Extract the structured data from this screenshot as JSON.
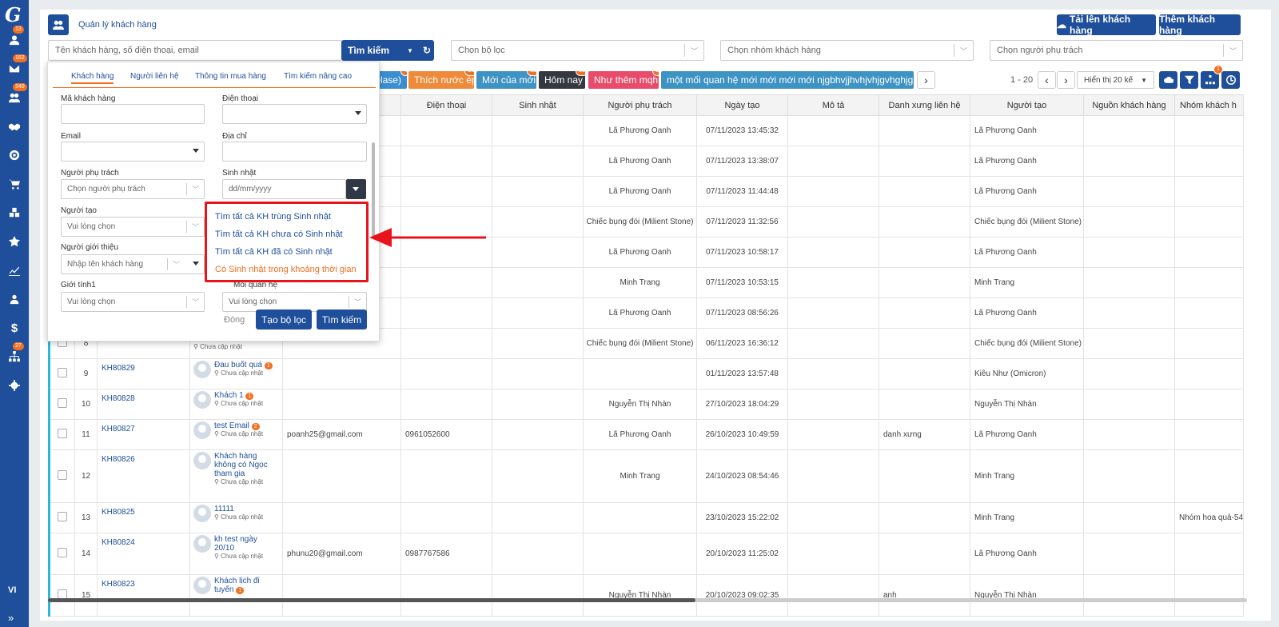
{
  "sidebar": {
    "logo": "G",
    "badges": {
      "b1": "13",
      "b2": "162",
      "b3": "340",
      "b4": "27"
    },
    "lang": "VI",
    "expand": "»"
  },
  "header": {
    "title": "Quản lý khách hàng",
    "upload_label": "Tải lên khách hàng",
    "add_label": "Thêm khách hàng"
  },
  "search": {
    "placeholder": "Tên khách hàng, số điện thoại, email",
    "button": "Tìm kiếm",
    "filter_placeholder": "Chọn bộ lọc",
    "group_placeholder": "Chọn nhóm khách hàng",
    "owner_placeholder": "Chọn người phụ trách"
  },
  "tags": [
    {
      "label": "elase)",
      "color": "#3b8fd1"
    },
    {
      "label": "Thích nước ép",
      "color": "#ee8a3a",
      "badge": "38"
    },
    {
      "label": "Mới của mới",
      "color": "#3d93c3",
      "badge": "13"
    },
    {
      "label": "Hôm nay",
      "color": "#35393f",
      "badge": "15"
    },
    {
      "label": "Như thêm mqh",
      "color": "#e94b6b",
      "badge": "0"
    },
    {
      "label": "một mối quan hệ mới mới mới mới njgbhvjjhvhjvhjgvhghjg",
      "color": "#3d93c3"
    }
  ],
  "tag0_badge": "4",
  "pagination": {
    "range": "1 - 20",
    "per_page": "Hiển thị 20 kế",
    "filter_badge": "1"
  },
  "columns": [
    "Điện thoại",
    "Sinh nhật",
    "Người phụ trách",
    "Ngày tạo",
    "Mô tả",
    "Danh xưng liên hệ",
    "Người tạo",
    "Nguồn khách hàng",
    "Nhóm khách h"
  ],
  "rows": [
    {
      "phone": "",
      "owner": "Lã Phương Oanh",
      "created": "07/11/2023 13:45:32",
      "title": "",
      "creator": "Lã Phương Oanh",
      "group": ""
    },
    {
      "phone": "",
      "owner": "Lã Phương Oanh",
      "created": "07/11/2023 13:38:07",
      "title": "",
      "creator": "Lã Phương Oanh",
      "group": ""
    },
    {
      "phone": "",
      "owner": "Lã Phương Oanh",
      "created": "07/11/2023 11:44:48",
      "title": "",
      "creator": "Lã Phương Oanh",
      "group": ""
    },
    {
      "phone": "",
      "owner": "Chiếc bụng đói (Milient Stone)",
      "created": "07/11/2023 11:32:56",
      "title": "",
      "creator": "Chiếc bụng đói (Milient Stone)",
      "group": ""
    },
    {
      "phone": "",
      "owner": "Lã Phương Oanh",
      "created": "07/11/2023 10:58:17",
      "title": "",
      "creator": "Lã Phương Oanh",
      "group": ""
    },
    {
      "phone": "",
      "owner": "Minh Trang",
      "created": "07/11/2023 10:53:15",
      "title": "",
      "creator": "Minh Trang",
      "group": ""
    },
    {
      "phone": "",
      "owner": "Lã Phương Oanh",
      "created": "07/11/2023 08:56:26",
      "title": "",
      "creator": "Lã Phương Oanh",
      "group": ""
    },
    {
      "idx": "8",
      "name_tail": "Chưa cập nhật",
      "email": "",
      "phone": "",
      "owner": "Chiếc bụng đói (Milient Stone)",
      "created": "06/11/2023 16:36:12",
      "title": "",
      "creator": "Chiếc bụng đói (Milient Stone)",
      "group": ""
    },
    {
      "idx": "9",
      "code": "KH80829",
      "name": "Đau buốt quá",
      "badge": "1",
      "updated": "Chưa cập nhật",
      "email": "",
      "phone": "",
      "owner": "",
      "created": "01/11/2023 13:57:48",
      "title": "",
      "creator": "Kiều Như (Omicron)",
      "group": ""
    },
    {
      "idx": "10",
      "code": "KH80828",
      "name": "Khách 1",
      "badge": "1",
      "updated": "Chưa cập nhật",
      "email": "",
      "phone": "",
      "owner": "Nguyễn Thị Nhàn",
      "created": "27/10/2023 18:04:29",
      "title": "",
      "creator": "Nguyễn Thị Nhàn",
      "group": ""
    },
    {
      "idx": "11",
      "code": "KH80827",
      "name": "test Email",
      "badge": "2",
      "updated": "Chưa cập nhật",
      "email": "poanh25@gmail.com",
      "phone": "0961052600",
      "owner": "Lã Phương Oanh",
      "created": "26/10/2023 10:49:59",
      "title": "danh xưng",
      "creator": "Lã Phương Oanh",
      "group": ""
    },
    {
      "idx": "12",
      "code": "KH80826",
      "name": "Khách hàng không có Ngọc tham gia",
      "badge": "",
      "updated": "Chưa cập nhật",
      "email": "",
      "phone": "",
      "owner": "Minh Trang",
      "created": "24/10/2023 08:54:46",
      "title": "",
      "creator": "Minh Trang",
      "group": ""
    },
    {
      "idx": "13",
      "code": "KH80825",
      "name": "11111",
      "badge": "",
      "updated": "Chưa cập nhật",
      "email": "",
      "phone": "",
      "owner": "",
      "created": "23/10/2023 15:22:02",
      "title": "",
      "creator": "Minh Trang",
      "group": "Nhóm hoa quả-54"
    },
    {
      "idx": "14",
      "code": "KH80824",
      "name": "kh test ngày 20/10",
      "badge": "",
      "updated": "Chưa cập nhật",
      "email": "phunu20@gmail.com",
      "phone": "0987767586",
      "owner": "",
      "created": "20/10/2023 11:25:02",
      "title": "",
      "creator": "Lã Phương Oanh",
      "group": ""
    },
    {
      "idx": "15",
      "code": "KH80823",
      "name": "Khách lịch đi tuyến",
      "badge": "1",
      "updated": "",
      "email": "",
      "phone": "",
      "owner": "Nguyễn Thị Nhàn",
      "created": "20/10/2023 09:02:35",
      "title": "anh",
      "creator": "Nguyễn Thị Nhàn",
      "group": ""
    }
  ],
  "filter_panel": {
    "tabs": [
      "Khách hàng",
      "Người liên hệ",
      "Thông tin mua hàng",
      "Tìm kiếm nâng cao"
    ],
    "labels": {
      "code": "Mã khách hàng",
      "phone": "Điện thoại",
      "email": "Email",
      "address": "Địa chỉ",
      "owner": "Người phụ trách",
      "birthday": "Sinh nhật",
      "creator": "Người tạo",
      "referrer": "Người giới thiệu",
      "gender": "Giới tính1",
      "relation": "Mối quan hệ"
    },
    "placeholders": {
      "owner": "Chọn người phụ trách",
      "birthday": "dd/mm/yyyy",
      "creator": "Vui lòng chọn",
      "referrer": "Nhập tên khách hàng",
      "gender": "Vui lòng chọn",
      "relation": "Vui lòng chọn"
    },
    "close": "Đóng",
    "create_filter": "Tạo bộ lọc",
    "search": "Tìm kiếm"
  },
  "birthday_options": [
    "Tìm tất cả KH trùng Sinh nhật",
    "Tìm tất cả KH chưa có Sinh nhật",
    "Tìm tất cả KH đã có Sinh nhật",
    "Có Sinh nhật trong khoảng thời gian"
  ],
  "colors": {
    "primary": "#1f4f9a",
    "accent": "#f36f21",
    "highlight": "#e8141b"
  }
}
